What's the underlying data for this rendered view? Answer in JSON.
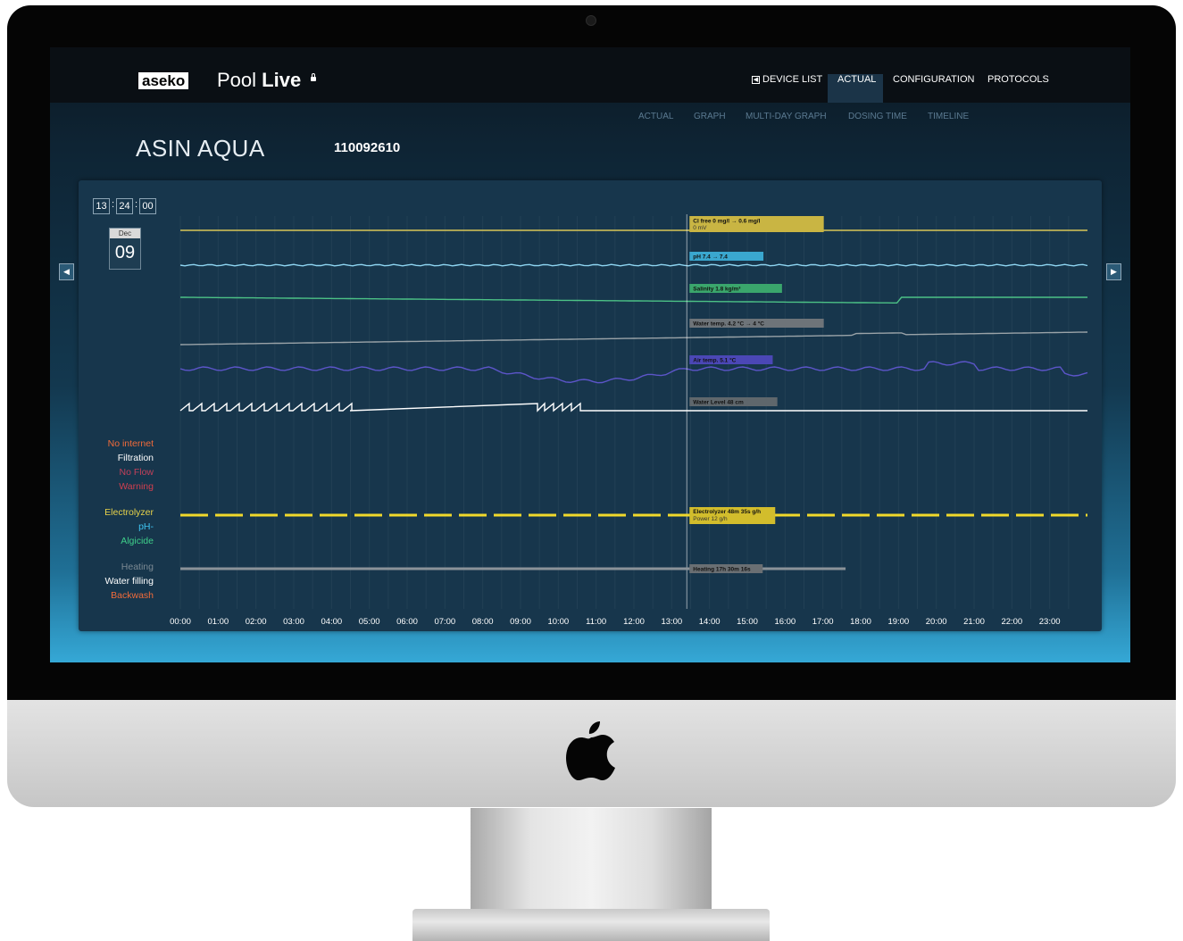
{
  "app": {
    "brand": "aseko",
    "name_regular": "Pool",
    "name_bold": "Live"
  },
  "nav": {
    "items": [
      {
        "label": "DEVICE LIST",
        "icon": "back-arrow-icon"
      },
      {
        "label": "ACTUAL",
        "active": true
      },
      {
        "label": "CONFIGURATION"
      },
      {
        "label": "PROTOCOLS"
      }
    ],
    "subtabs": [
      "ACTUAL",
      "GRAPH",
      "MULTI-DAY GRAPH",
      "DOSING TIME",
      "TIMELINE"
    ]
  },
  "pool": {
    "name": "ASIN AQUA",
    "id": "110092610"
  },
  "clock": {
    "hours": "13",
    "minutes": "24",
    "seconds": "00"
  },
  "date": {
    "month": "Dec",
    "day": "09"
  },
  "status_labels": [
    {
      "label": "No internet",
      "color": "#f26b3a"
    },
    {
      "label": "Filtration",
      "color": "#ffffff"
    },
    {
      "label": "No Flow",
      "color": "#c2405a"
    },
    {
      "label": "Warning",
      "color": "#d23f4f"
    },
    {
      "label": "Electrolyzer",
      "color": "#e8d34a"
    },
    {
      "label": "pH-",
      "color": "#3ec3f0"
    },
    {
      "label": "Algicide",
      "color": "#3fcf8a"
    },
    {
      "label": "Heating",
      "color": "#7c8a93"
    },
    {
      "label": "Water filling",
      "color": "#ffffff"
    },
    {
      "label": "Backwash",
      "color": "#f26b3a"
    }
  ],
  "chart_data": {
    "type": "line",
    "x_labels": [
      "00:00",
      "01:00",
      "02:00",
      "03:00",
      "04:00",
      "05:00",
      "06:00",
      "07:00",
      "08:00",
      "09:00",
      "10:00",
      "11:00",
      "12:00",
      "13:00",
      "14:00",
      "15:00",
      "16:00",
      "17:00",
      "18:00",
      "19:00",
      "20:00",
      "21:00",
      "22:00",
      "23:00"
    ],
    "cursor_time": "13:24",
    "series": [
      {
        "key": "cl",
        "color": "#d8c657",
        "tag": "Cl free 0 mg/l  →  0.6 mg/l",
        "tag2": "0 mV",
        "tag_bg": "#c9b543"
      },
      {
        "key": "ph",
        "color": "#8fd6f2",
        "tag": "pH 7.4  →  7.4",
        "tag_bg": "#3aa7cf"
      },
      {
        "key": "salt",
        "color": "#4cc286",
        "tag": "Salinity 1.8 kg/m³",
        "tag_bg": "#3aa66c"
      },
      {
        "key": "water",
        "color": "#9aa3a8",
        "tag": "Water temp. 4.2 °C  →  4 °C",
        "tag_bg": "#6e7479"
      },
      {
        "key": "air",
        "color": "#5c55c9",
        "tag": "Air temp. 5.1 °C",
        "tag_bg": "#4b47b6"
      },
      {
        "key": "level",
        "color": "#ffffff",
        "tag": "Water Level 48 cm",
        "tag_bg": "#5f676c"
      }
    ],
    "status_tags": [
      {
        "key": "electrolyzer",
        "tag": "Electrolyzer 48m 35s g/h",
        "tag2": "Power 12 g/h",
        "tag_bg": "#d2bd2c"
      },
      {
        "key": "heating",
        "tag": "Heating 17h 30m 16s",
        "tag_bg": "#6a6f73"
      }
    ]
  },
  "colors": {
    "accent": "#1b3448",
    "panel": "#17364c"
  }
}
